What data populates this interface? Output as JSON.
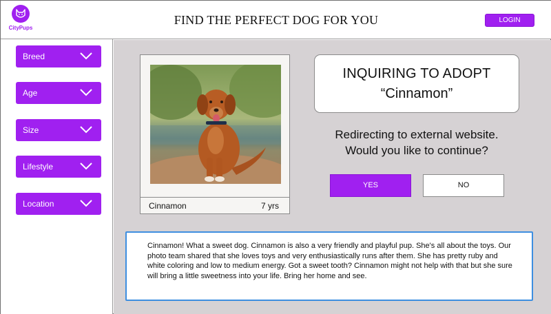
{
  "header": {
    "logo_text": "CityPups",
    "title": "FIND THE PERFECT DOG FOR YOU",
    "login_label": "LOGIN"
  },
  "sidebar": {
    "filters": [
      {
        "label": "Breed"
      },
      {
        "label": "Age"
      },
      {
        "label": "Size"
      },
      {
        "label": "Lifestyle"
      },
      {
        "label": "Location"
      }
    ]
  },
  "dog": {
    "name": "Cinnamon",
    "age": "7 yrs",
    "photo_icon": "dog-photo"
  },
  "dialog": {
    "title": "INQUIRING TO ADOPT",
    "name_quoted": "“Cinnamon”",
    "message_line1": "Redirecting to external website.",
    "message_line2": "Would you like to continue?",
    "yes_label": "YES",
    "no_label": "NO"
  },
  "description": "Cinnamon! What a sweet dog. Cinnamon is also a very friendly and playful pup. She's all about the toys. Our photo team shared that she loves toys and very enthusiastically runs after them. She has pretty ruby and white coloring and low to medium energy. Got a sweet tooth? Cinnamon might not help with that but she sure will bring a little sweetness into your life. Bring her home and see.",
  "colors": {
    "accent": "#a020f0",
    "panel_bg": "#d6d2d4",
    "description_border": "#3d8ee0"
  }
}
